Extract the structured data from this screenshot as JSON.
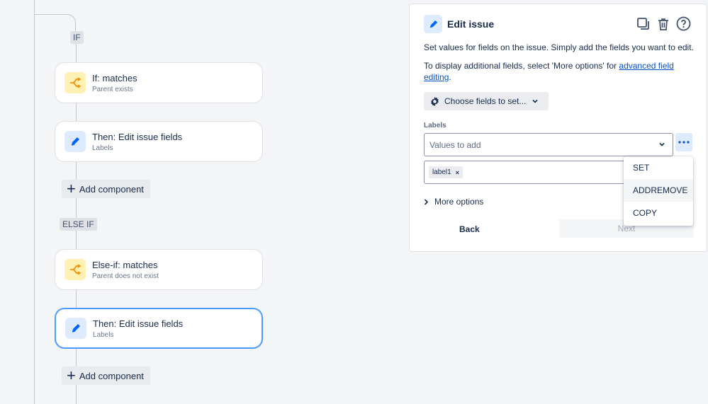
{
  "flow": {
    "if_tag": "IF",
    "else_if_tag": "ELSE IF",
    "cards": [
      {
        "title": "If: matches",
        "subtitle": "Parent exists",
        "icon": "branch-icon"
      },
      {
        "title": "Then: Edit issue fields",
        "subtitle": "Labels",
        "icon": "pencil-icon"
      },
      {
        "title": "Else-if: matches",
        "subtitle": "Parent does not exist",
        "icon": "branch-icon"
      },
      {
        "title": "Then: Edit issue fields",
        "subtitle": "Labels",
        "icon": "pencil-icon",
        "selected": true
      }
    ],
    "add_component_label": "Add component"
  },
  "panel": {
    "title": "Edit issue",
    "description": "Set values for fields on the issue. Simply add the fields you want to edit.",
    "display_text_pre": "To display additional fields, select 'More options' for ",
    "display_link": "advanced field editing",
    "display_text_post": ".",
    "choose_fields_label": "Choose fields to set...",
    "field_label": "Labels",
    "select_placeholder": "Values to add",
    "chips": [
      "label1"
    ],
    "more_options_label": "More options",
    "back_label": "Back",
    "next_label": "Next"
  },
  "dropdown": {
    "items": [
      "SET",
      "ADDREMOVE",
      "COPY"
    ],
    "hovered_index": 1
  },
  "colors": {
    "accent": "#0052cc",
    "selected_border": "#4c9aff",
    "condition_icon_bg": "#fff0b3",
    "action_icon_bg": "#deebff"
  }
}
